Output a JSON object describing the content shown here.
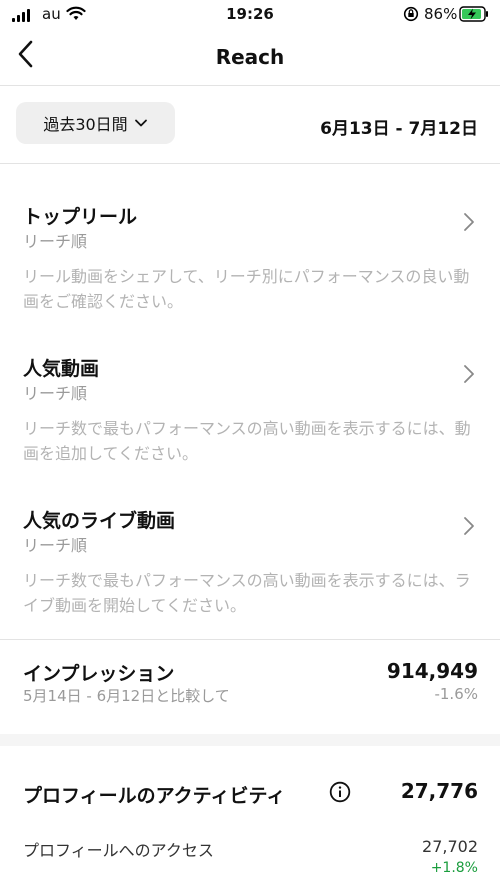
{
  "status_bar": {
    "carrier": "au",
    "time": "19:26",
    "battery": "86%"
  },
  "nav": {
    "title": "Reach",
    "back_icon": "chevron-left-icon"
  },
  "range": {
    "selector_label": "過去30日間",
    "dates": "6月13日 - 7月12日"
  },
  "sections": [
    {
      "title": "トップリール",
      "subtitle": "リーチ順",
      "description": "リール動画をシェアして、リーチ別にパフォーマンスの良い動画をご確認ください。"
    },
    {
      "title": "人気動画",
      "subtitle": "リーチ順",
      "description": "リーチ数で最もパフォーマンスの高い動画を表示するには、動画を追加してください。"
    },
    {
      "title": "人気のライブ動画",
      "subtitle": "リーチ順",
      "description": "リーチ数で最もパフォーマンスの高い動画を表示するには、ライブ動画を開始してください。"
    }
  ],
  "impressions": {
    "title": "インプレッション",
    "comparison": "5月14日 - 6月12日と比較して",
    "value": "914,949",
    "change": "-1.6%"
  },
  "profile_activity": {
    "title": "プロフィールのアクティビティ",
    "value": "27,776",
    "row_label": "プロフィールへのアクセス",
    "row_value": "27,702",
    "row_change": "+1.8%"
  },
  "colors": {
    "positive": "#1b9d3e",
    "muted_text": "#9a9a9a",
    "battery_fill": "#35c759"
  }
}
